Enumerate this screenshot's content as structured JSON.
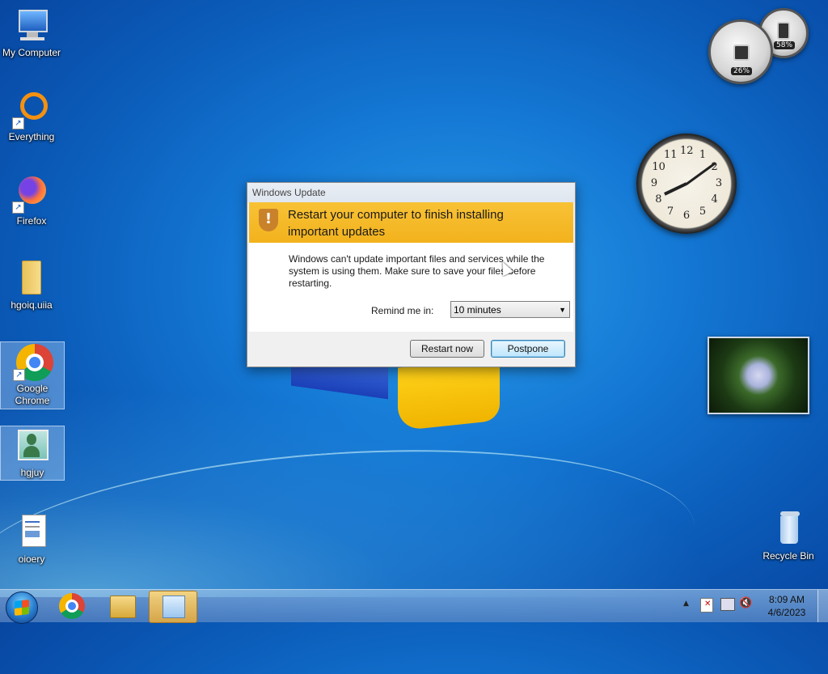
{
  "desktop": {
    "icons": [
      {
        "label": "My Computer",
        "icon": "computer-icon"
      },
      {
        "label": "Everything",
        "icon": "everything-icon"
      },
      {
        "label": "Firefox",
        "icon": "firefox-icon"
      },
      {
        "label": "hgoiq.uiia",
        "icon": "folder-icon"
      },
      {
        "label": "Google Chrome",
        "icon": "chrome-icon"
      },
      {
        "label": "hgjuy",
        "icon": "user-icon"
      },
      {
        "label": "oioery",
        "icon": "document-icon"
      },
      {
        "label": "Recycle Bin",
        "icon": "recycle-bin-icon"
      }
    ]
  },
  "gadgets": {
    "cpu_meter": {
      "cpu_percent": "26%",
      "memory_percent": "58%"
    },
    "clock": {
      "numerals": [
        "12",
        "1",
        "2",
        "3",
        "4",
        "5",
        "6",
        "7",
        "8",
        "9",
        "10",
        "11"
      ],
      "hour": 8,
      "minute": 9
    }
  },
  "dialog": {
    "title": "Windows Update",
    "headline": "Restart your computer to finish installing important updates",
    "message": "Windows can't update important files and services while the system is using them. Make sure to save your files before restarting.",
    "remind_label": "Remind me in:",
    "remind_value": "10 minutes",
    "restart_button": "Restart now",
    "postpone_button": "Postpone"
  },
  "taskbar": {
    "buttons": [
      "chrome-icon",
      "file-explorer-icon",
      "windows-update-icon"
    ],
    "time": "8:09 AM",
    "date": "4/6/2023",
    "tray_icons": [
      "show-hidden-icons-arrow",
      "action-center-flag-icon",
      "network-icon",
      "volume-muted-icon"
    ]
  },
  "colors": {
    "banner": "#f2b21d",
    "default_button": "#3c7fb1"
  }
}
